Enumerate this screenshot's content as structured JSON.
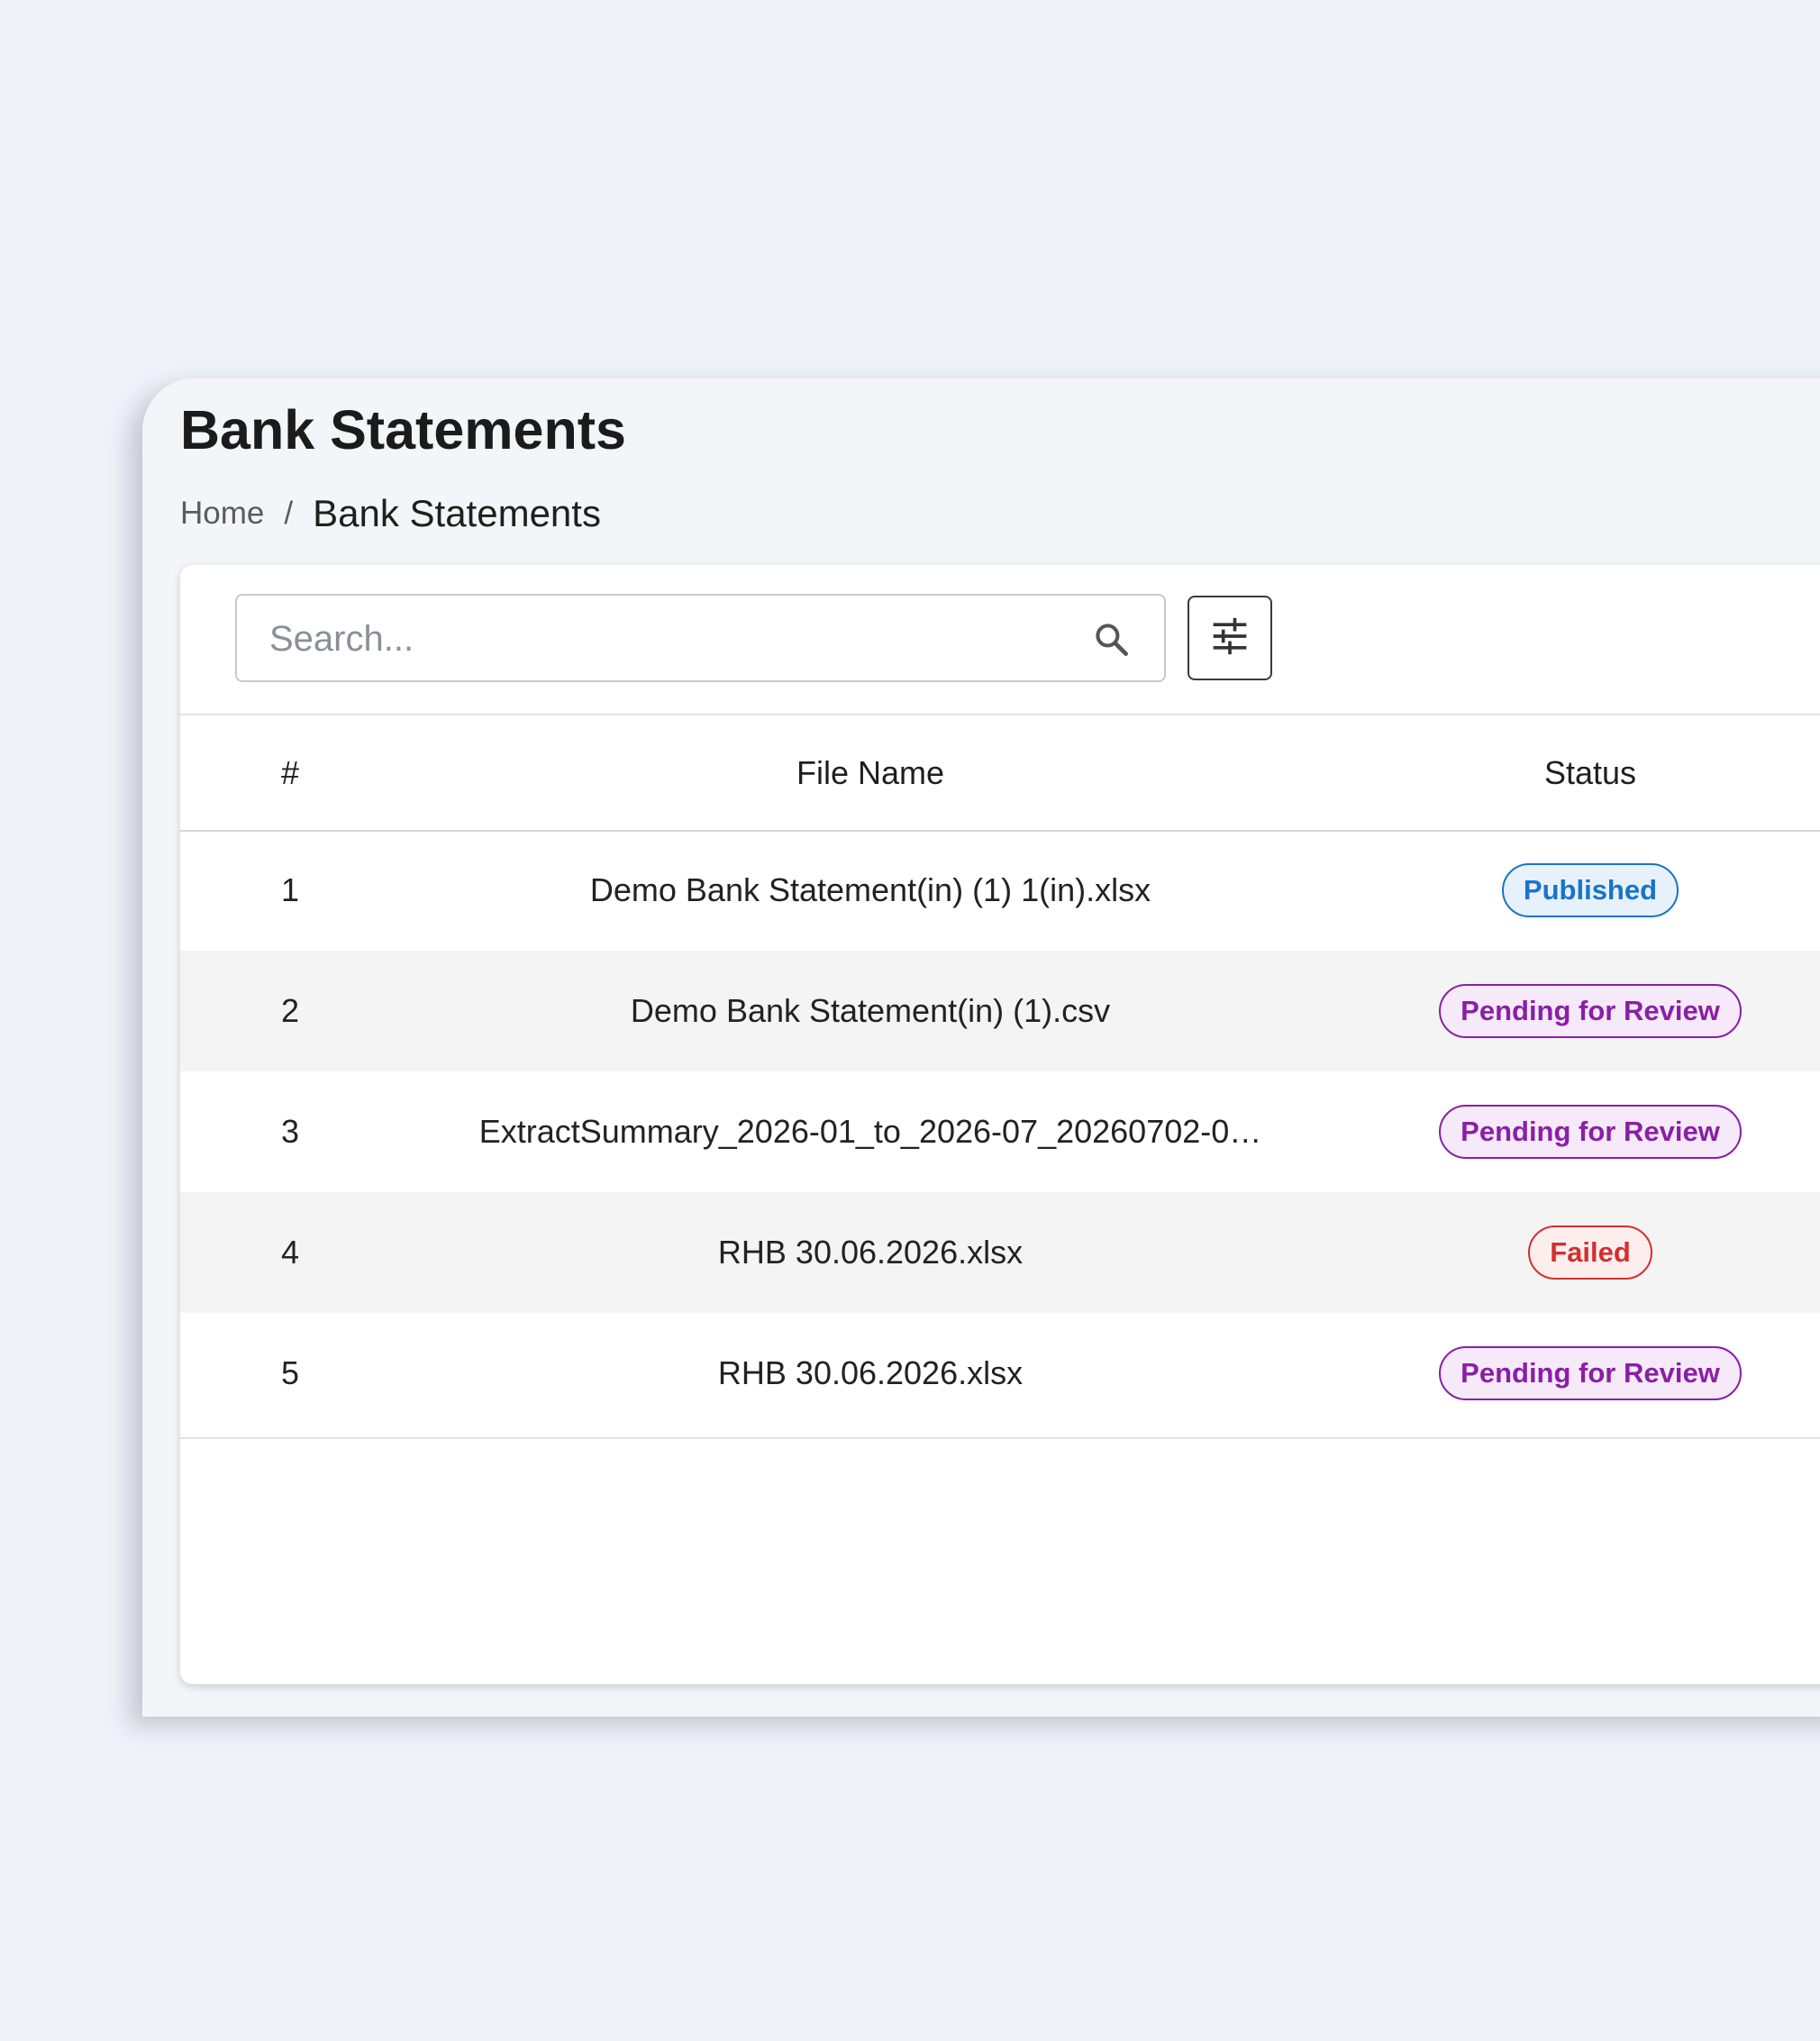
{
  "page": {
    "title": "Bank Statements"
  },
  "breadcrumb": {
    "home": "Home",
    "separator": "/",
    "current": "Bank Statements"
  },
  "toolbar": {
    "search_placeholder": "Search...",
    "search_icon": "search-icon",
    "filter_icon": "tune-icon"
  },
  "table": {
    "headers": {
      "number": "#",
      "file_name": "File Name",
      "status": "Status"
    },
    "rows": [
      {
        "number": "1",
        "file_name": "Demo Bank Statement(in) (1) 1(in).xlsx",
        "status": "Published",
        "status_type": "published"
      },
      {
        "number": "2",
        "file_name": "Demo Bank Statement(in) (1).csv",
        "status": "Pending for Review",
        "status_type": "pending"
      },
      {
        "number": "3",
        "file_name": "ExtractSummary_2026-01_to_2026-07_20260702-0…",
        "status": "Pending for Review",
        "status_type": "pending"
      },
      {
        "number": "4",
        "file_name": "RHB 30.06.2026.xlsx",
        "status": "Failed",
        "status_type": "failed"
      },
      {
        "number": "5",
        "file_name": "RHB 30.06.2026.xlsx",
        "status": "Pending for Review",
        "status_type": "pending"
      }
    ]
  },
  "colors": {
    "background": "#eff2f9",
    "published": "#1a73c8",
    "pending": "#8a1fa6",
    "failed": "#d32f2f"
  }
}
